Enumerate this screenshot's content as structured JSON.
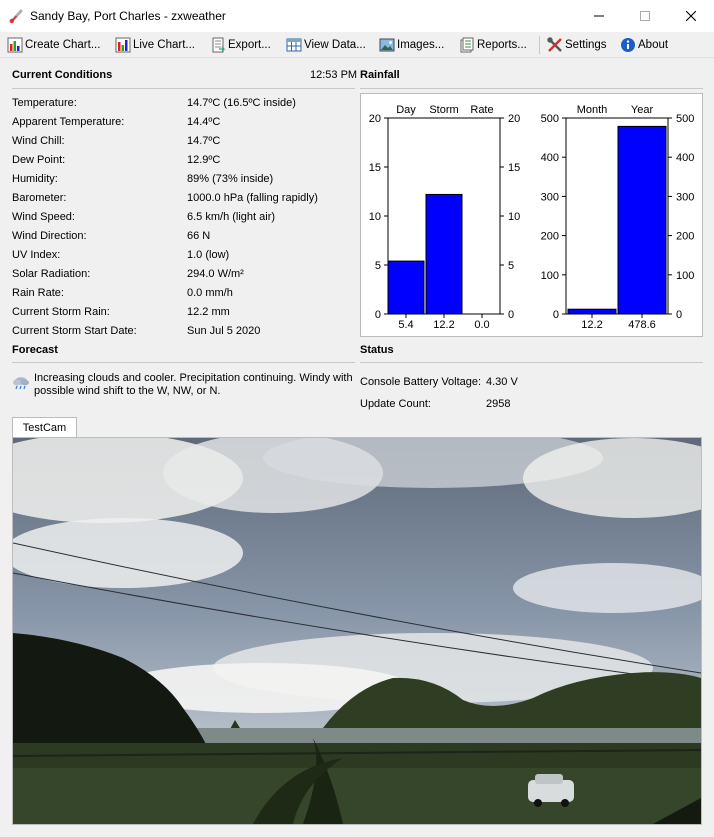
{
  "window": {
    "title": "Sandy Bay, Port Charles - zxweather"
  },
  "toolbar": {
    "create_chart": "Create Chart...",
    "live_chart": "Live Chart...",
    "export": "Export...",
    "view_data": "View Data...",
    "images": "Images...",
    "reports": "Reports...",
    "settings": "Settings",
    "about": "About"
  },
  "current": {
    "heading": "Current Conditions",
    "time": "12:53 PM",
    "rows": [
      {
        "label": "Temperature:",
        "value": "14.7ºC (16.5ºC inside)"
      },
      {
        "label": "Apparent Temperature:",
        "value": "14.4ºC"
      },
      {
        "label": "Wind Chill:",
        "value": "14.7ºC"
      },
      {
        "label": "Dew Point:",
        "value": "12.9ºC"
      },
      {
        "label": "Humidity:",
        "value": "89% (73% inside)"
      },
      {
        "label": "Barometer:",
        "value": "1000.0 hPa (falling rapidly)"
      },
      {
        "label": "Wind Speed:",
        "value": "6.5 km/h (light air)"
      },
      {
        "label": "Wind Direction:",
        "value": "66 N"
      },
      {
        "label": "UV Index:",
        "value": "1.0 (low)"
      },
      {
        "label": "Solar Radiation:",
        "value": "294.0 W/m²"
      },
      {
        "label": "Rain Rate:",
        "value": "0.0 mm/h"
      },
      {
        "label": "Current Storm Rain:",
        "value": "12.2 mm"
      },
      {
        "label": "Current Storm Start Date:",
        "value": "Sun Jul 5 2020"
      }
    ]
  },
  "rainfall": {
    "heading": "Rainfall"
  },
  "chart_data": [
    {
      "type": "bar",
      "categories": [
        "Day",
        "Storm",
        "Rate"
      ],
      "values": [
        5.4,
        12.2,
        0.0
      ],
      "value_labels": [
        "5.4",
        "12.2",
        "0.0"
      ],
      "ylim": [
        0,
        20
      ],
      "yticks": [
        "0",
        "5",
        "10",
        "15",
        "20"
      ],
      "bar_color": "#0000ff",
      "axis": "both-sides"
    },
    {
      "type": "bar",
      "categories": [
        "Month",
        "Year"
      ],
      "values": [
        12.2,
        478.6
      ],
      "value_labels": [
        "12.2",
        "478.6"
      ],
      "ylim": [
        0,
        500
      ],
      "yticks": [
        "0",
        "100",
        "200",
        "300",
        "400",
        "500"
      ],
      "bar_color": "#0000ff",
      "axis": "both-sides"
    }
  ],
  "forecast": {
    "heading": "Forecast",
    "icon": "rain-cloud-icon",
    "text": "Increasing clouds and cooler. Precipitation continuing. Windy with possible wind shift to the W, NW, or N."
  },
  "status": {
    "heading": "Status",
    "rows": [
      {
        "label": "Console Battery Voltage:",
        "value": "4.30 V"
      },
      {
        "label": "Update Count:",
        "value": "2958"
      }
    ]
  },
  "camera": {
    "tab": "TestCam"
  }
}
